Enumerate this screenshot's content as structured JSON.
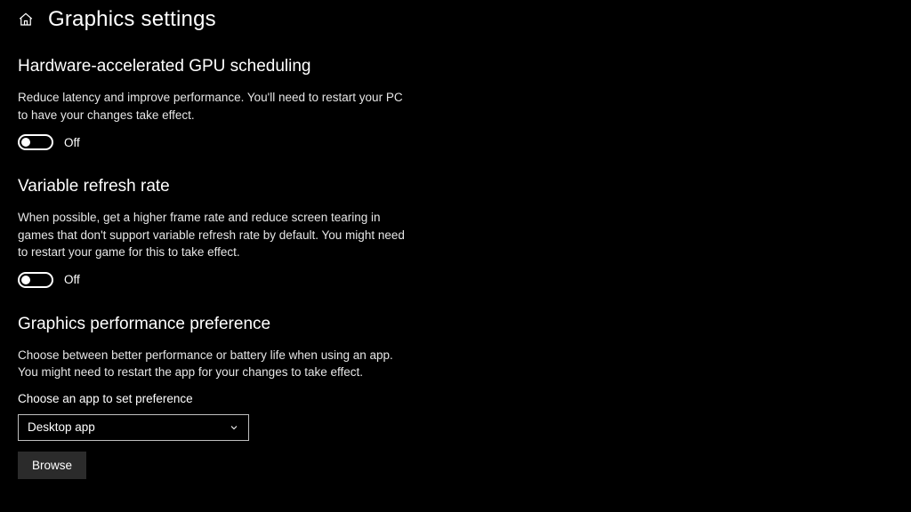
{
  "header": {
    "title": "Graphics settings"
  },
  "sections": {
    "gpu": {
      "title": "Hardware-accelerated GPU scheduling",
      "desc": "Reduce latency and improve performance. You'll need to restart your PC to have your changes take effect.",
      "toggle_state": "Off"
    },
    "vrr": {
      "title": "Variable refresh rate",
      "desc": "When possible, get a higher frame rate and reduce screen tearing in games that don't support variable refresh rate by default. You might need to restart your game for this to take effect.",
      "toggle_state": "Off"
    },
    "perf": {
      "title": "Graphics performance preference",
      "desc": "Choose between better performance or battery life when using an app. You might need to restart the app for your changes to take effect.",
      "field_label": "Choose an app to set preference",
      "dropdown_value": "Desktop app",
      "browse_label": "Browse"
    }
  }
}
